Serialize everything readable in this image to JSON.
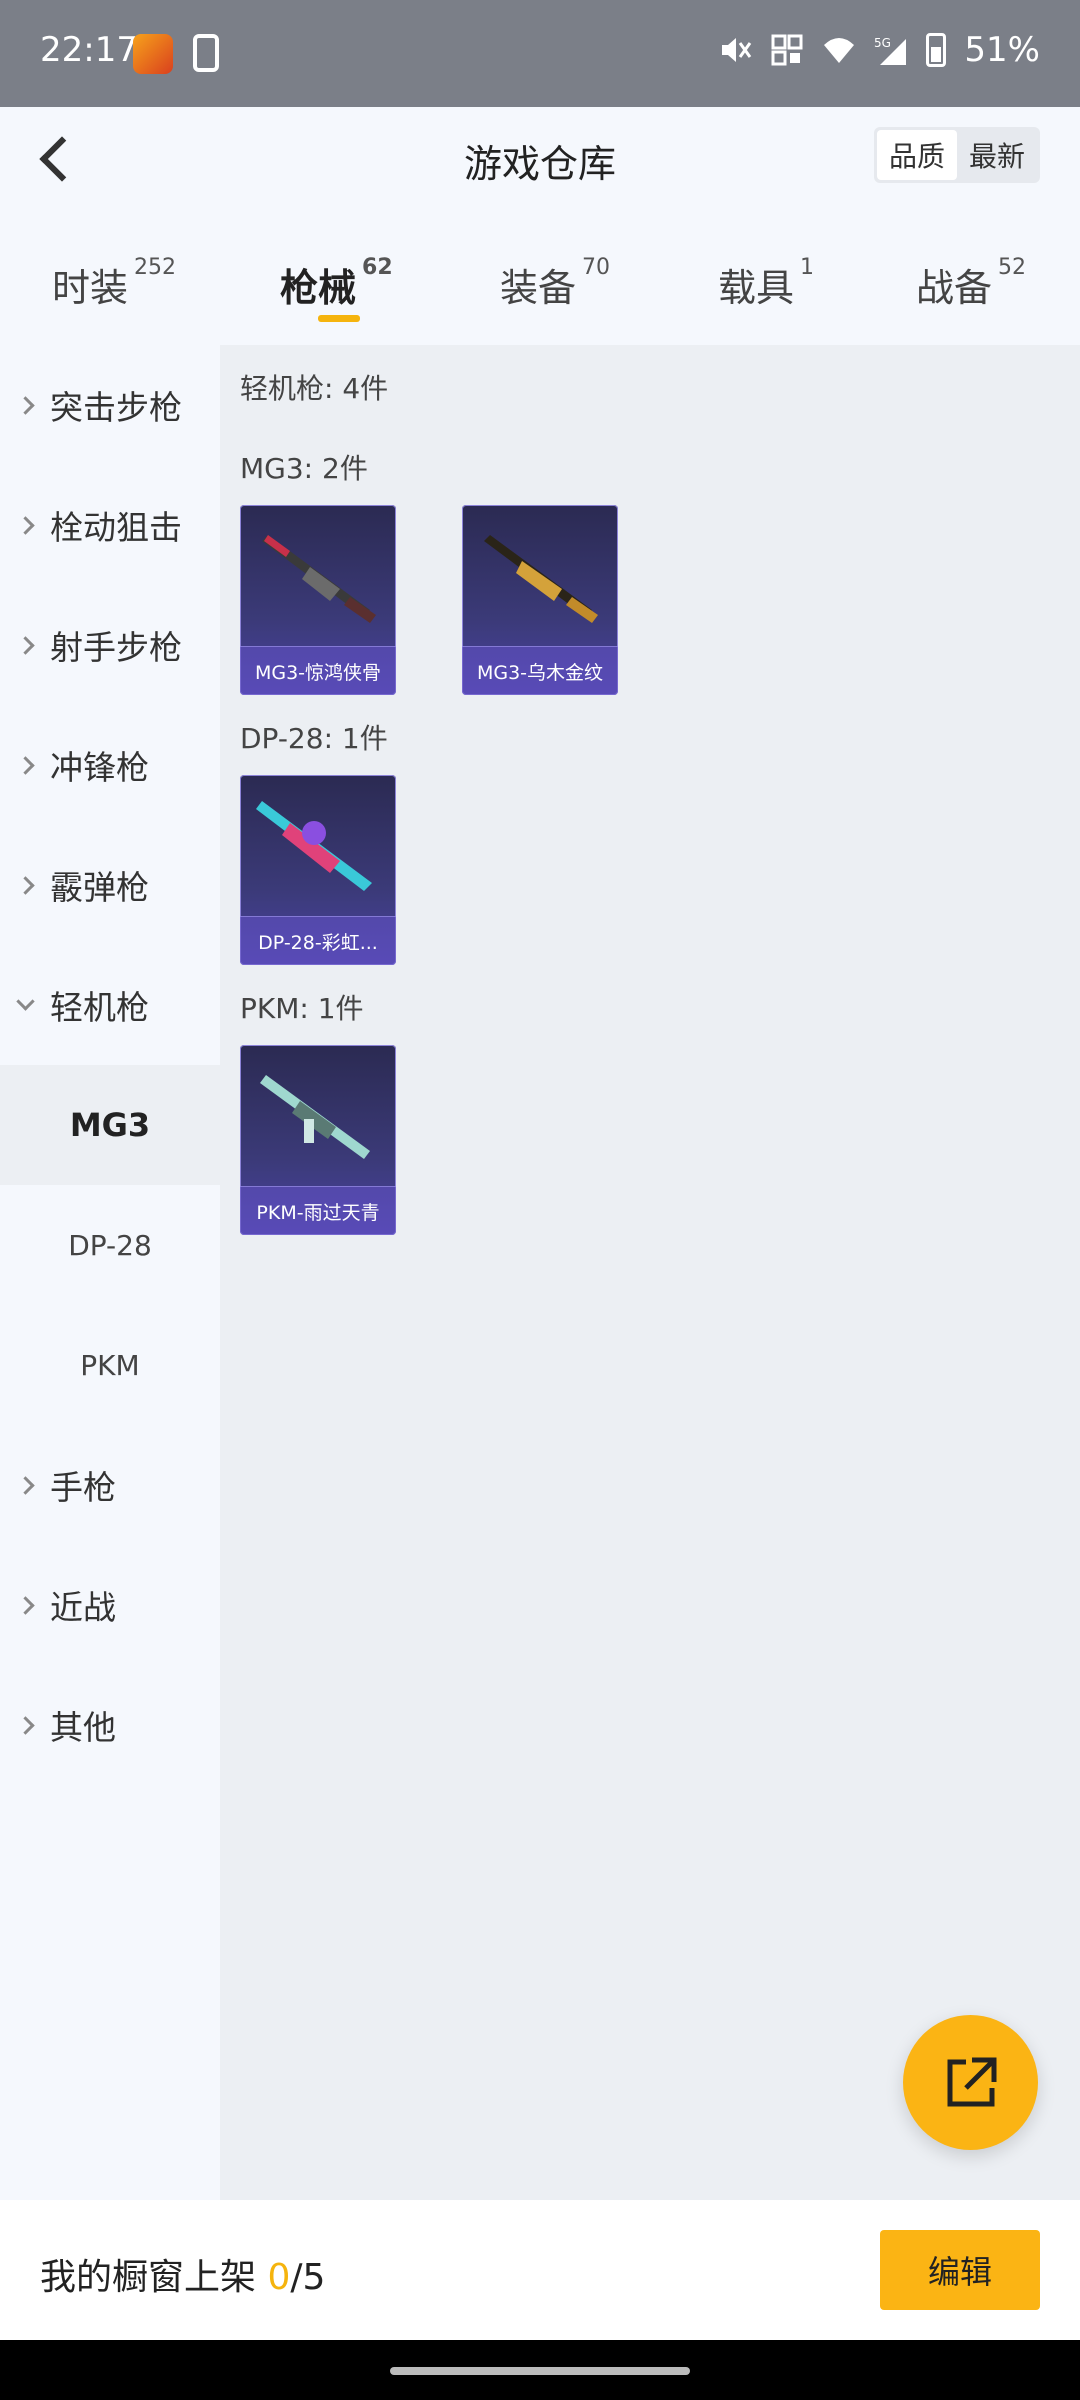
{
  "status_bar": {
    "time": "22:17",
    "battery": "51%"
  },
  "header": {
    "title": "游戏仓库",
    "sort_options": [
      "品质",
      "最新"
    ],
    "sort_active": "品质"
  },
  "tabs": [
    {
      "label": "时装",
      "count": "252"
    },
    {
      "label": "枪械",
      "count": "62"
    },
    {
      "label": "装备",
      "count": "70"
    },
    {
      "label": "载具",
      "count": "1"
    },
    {
      "label": "战备",
      "count": "52"
    }
  ],
  "sidebar": {
    "categories": [
      "突击步枪",
      "栓动狙击",
      "射手步枪",
      "冲锋枪",
      "霰弹枪",
      "轻机枪"
    ],
    "subcategories": [
      "MG3",
      "DP-28",
      "PKM"
    ],
    "more_categories": [
      "手枪",
      "近战",
      "其他"
    ]
  },
  "content": {
    "summary": "轻机枪: 4件",
    "groups": [
      {
        "title": "MG3: 2件",
        "items": [
          "MG3-惊鸿侠骨",
          "MG3-乌木金纹"
        ]
      },
      {
        "title": "DP-28: 1件",
        "items": [
          "DP-28-彩虹..."
        ]
      },
      {
        "title": "PKM: 1件",
        "items": [
          "PKM-雨过天青"
        ]
      }
    ]
  },
  "bottom": {
    "showcase_label": "我的橱窗上架",
    "showcase_count": "0",
    "showcase_total": "/5",
    "edit_label": "编辑"
  },
  "icons": {
    "fab": "share-external-icon"
  },
  "colors": {
    "accent": "#fbb414",
    "card_bg": "#3b3a78"
  }
}
